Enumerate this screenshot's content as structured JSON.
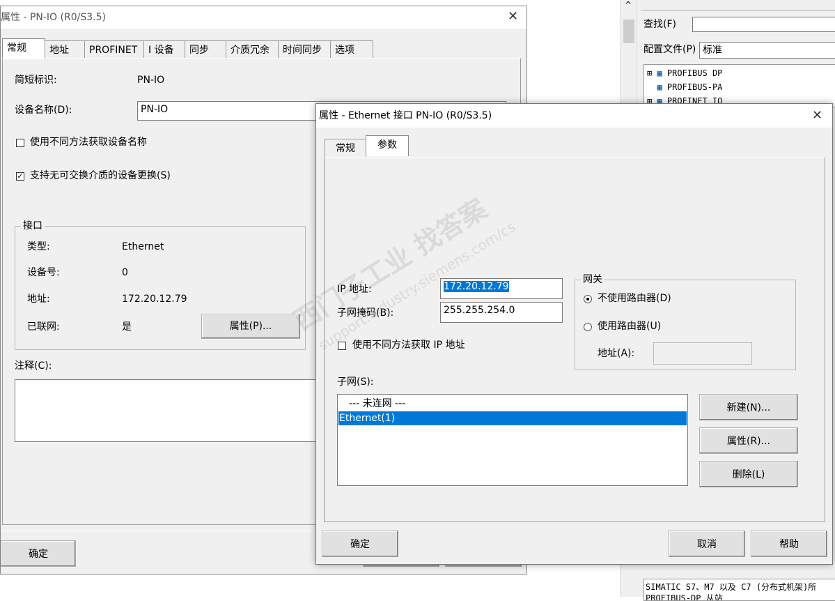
{
  "bg_window": {
    "search_label": "查找(F)",
    "profile_label": "配置文件(P)",
    "profile_value": "标准",
    "tree": [
      "PROFIBUS DP",
      "PROFIBUS-PA",
      "PROFINET IO"
    ],
    "status_line1": "SIMATIC S7、M7 以及 C7 (分布式机架)所",
    "status_line2": "PROFIBUS-DP 从站"
  },
  "dialog1": {
    "title": "属性 - PN-IO (R0/S3.5)",
    "tabs": [
      "常规",
      "地址",
      "PROFINET",
      "I 设备",
      "同步",
      "介质冗余",
      "时间同步",
      "选项"
    ],
    "short_id_label": "简短标识:",
    "short_id_value": "PN-IO",
    "device_name_label": "设备名称(D):",
    "device_name_value": "PN-IO",
    "check_alt_name": "使用不同方法获取设备名称",
    "check_support": "支持无可交换介质的设备更换(S)",
    "interface": {
      "legend": "接口",
      "type_label": "类型:",
      "type_value": "Ethernet",
      "device_no_label": "设备号:",
      "device_no_value": "0",
      "address_label": "地址:",
      "address_value": "172.20.12.79",
      "networked_label": "已联网:",
      "networked_value": "是",
      "properties_button": "属性(P)..."
    },
    "comment_label": "注释(C):",
    "ok_button": "确定"
  },
  "dialog2": {
    "title": "属性 - Ethernet 接口  PN-IO (R0/S3.5)",
    "tabs": [
      "常规",
      "参数"
    ],
    "ip_label": "IP 地址:",
    "ip_value": "172.20.12.79",
    "mask_label": "子网掩码(B):",
    "mask_value": "255.255.254.0",
    "check_alt_ip": "使用不同方法获取 IP 地址",
    "gateway": {
      "legend": "网关",
      "no_router": "不使用路由器(D)",
      "use_router": "使用路由器(U)",
      "address_label": "地址(A):",
      "address_value": ""
    },
    "subnet_label": "子网(S):",
    "subnets": [
      "--- 未连网 ---",
      "Ethernet(1)"
    ],
    "new_button": "新建(N)...",
    "properties_button": "属性(R)...",
    "delete_button": "删除(L)",
    "ok_button": "确定",
    "cancel_button": "取消",
    "help_button": "帮助"
  },
  "watermark": {
    "line1": "西门子工业 找答案",
    "line2": "support.industry.siemens.com/cs"
  },
  "colors": {
    "dialog_bg": "#f0f0f0",
    "selection": "#0078d7"
  }
}
